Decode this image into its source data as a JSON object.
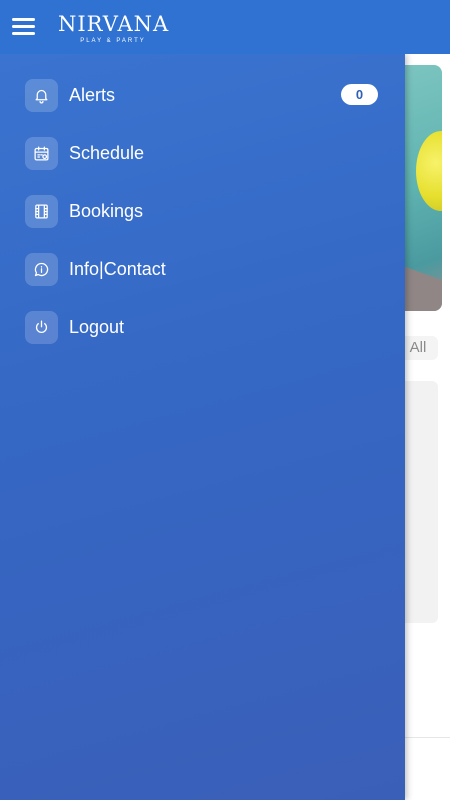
{
  "app": {
    "logo_title": "NIRVANA",
    "logo_subtitle": "PLAY & PARTY"
  },
  "drawer": {
    "items": [
      {
        "label": "Alerts",
        "icon": "bell-icon",
        "badge": "0"
      },
      {
        "label": "Schedule",
        "icon": "calendar-icon"
      },
      {
        "label": "Bookings",
        "icon": "film-icon"
      },
      {
        "label": "Info|Contact",
        "icon": "chat-info-icon"
      },
      {
        "label": "Logout",
        "icon": "power-icon"
      }
    ]
  },
  "background": {
    "filter_chip": "All"
  },
  "colors": {
    "appbar": "#2f72d2",
    "drawer_top": "#3a74d0",
    "drawer_bottom": "#3a5fb8"
  }
}
